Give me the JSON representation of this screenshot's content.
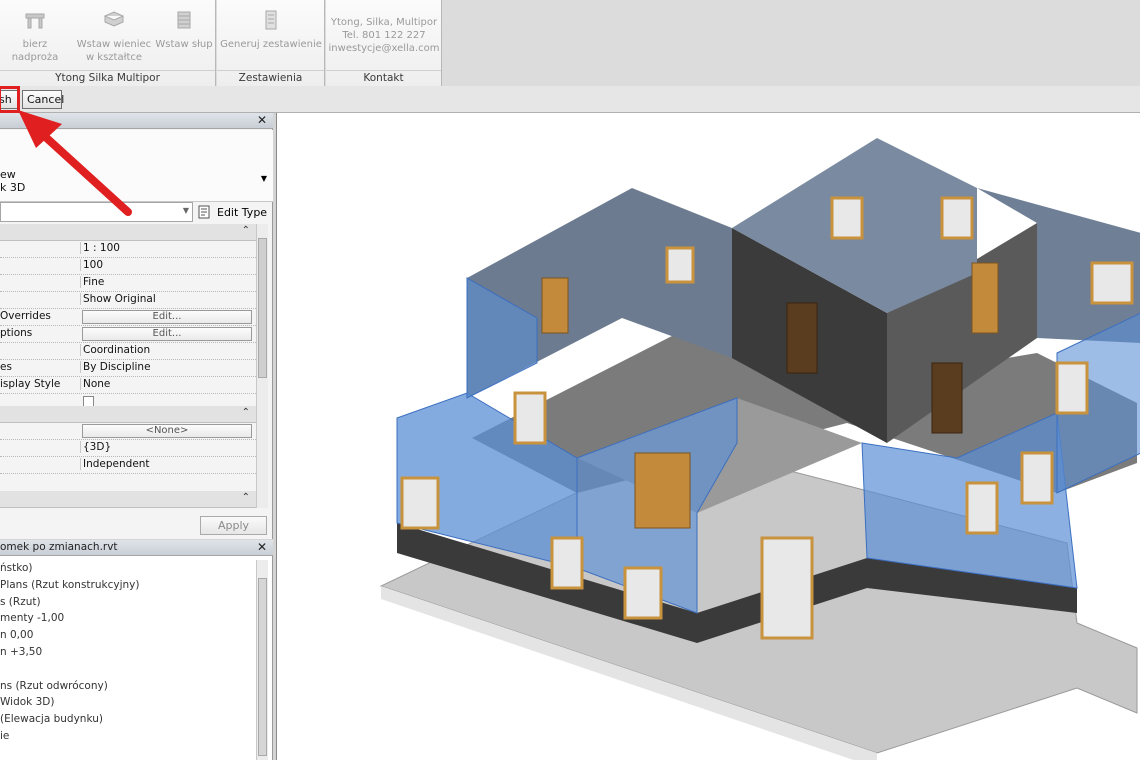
{
  "ribbon": {
    "groups": [
      {
        "label": "Ytong Silka Multipor",
        "buttons": [
          {
            "line1": "bierz nadproża",
            "line2": ""
          },
          {
            "line1": "Wstaw wieniec",
            "line2": "w kształtce"
          },
          {
            "line1": "Wstaw słup",
            "line2": ""
          }
        ]
      },
      {
        "label": "Zestawienia",
        "buttons": [
          {
            "line1": "Generuj zestawienie",
            "line2": ""
          }
        ]
      },
      {
        "label": "Kontakt",
        "lines": [
          "Ytong, Silka, Multipor",
          "Tel. 801 122 227",
          "inwestycje@xella.com"
        ]
      }
    ]
  },
  "options_bar": {
    "finish_label": "sh",
    "cancel_label": "Cancel"
  },
  "properties": {
    "type_line1": "ew",
    "type_line2": "k 3D",
    "edit_type_label": "Edit Type",
    "rows": [
      {
        "k": "",
        "v": "1 : 100"
      },
      {
        "k": "",
        "v": "100"
      },
      {
        "k": "",
        "v": "Fine"
      },
      {
        "k": "",
        "v": "Show Original"
      },
      {
        "k": " Overrides",
        "v": "Edit..."
      },
      {
        "k": "ptions",
        "v": "Edit..."
      },
      {
        "k": "",
        "v": "Coordination"
      },
      {
        "k": "es",
        "v": "By Discipline"
      },
      {
        "k": "isplay Style",
        "v": "None"
      }
    ],
    "rows2": [
      {
        "k": "",
        "v": "<None>"
      },
      {
        "k": "",
        "v": "{3D}"
      },
      {
        "k": "",
        "v": "Independent"
      }
    ],
    "apply_label": "Apply"
  },
  "browser": {
    "title": "omek po zmianach.rvt",
    "items": [
      "ństko)",
      "Plans (Rzut konstrukcyjny)",
      "s (Rzut)",
      "menty -1,00",
      "n 0,00",
      "n +3,50",
      "",
      "ns (Rzut odwrócony)",
      "Widok 3D)",
      "(Elewacja budynku)",
      "ie"
    ]
  },
  "colors": {
    "highlight": "#e02020",
    "wall_blue": "#5b8fd6",
    "ribbon_bg": "#f4f4f4"
  }
}
